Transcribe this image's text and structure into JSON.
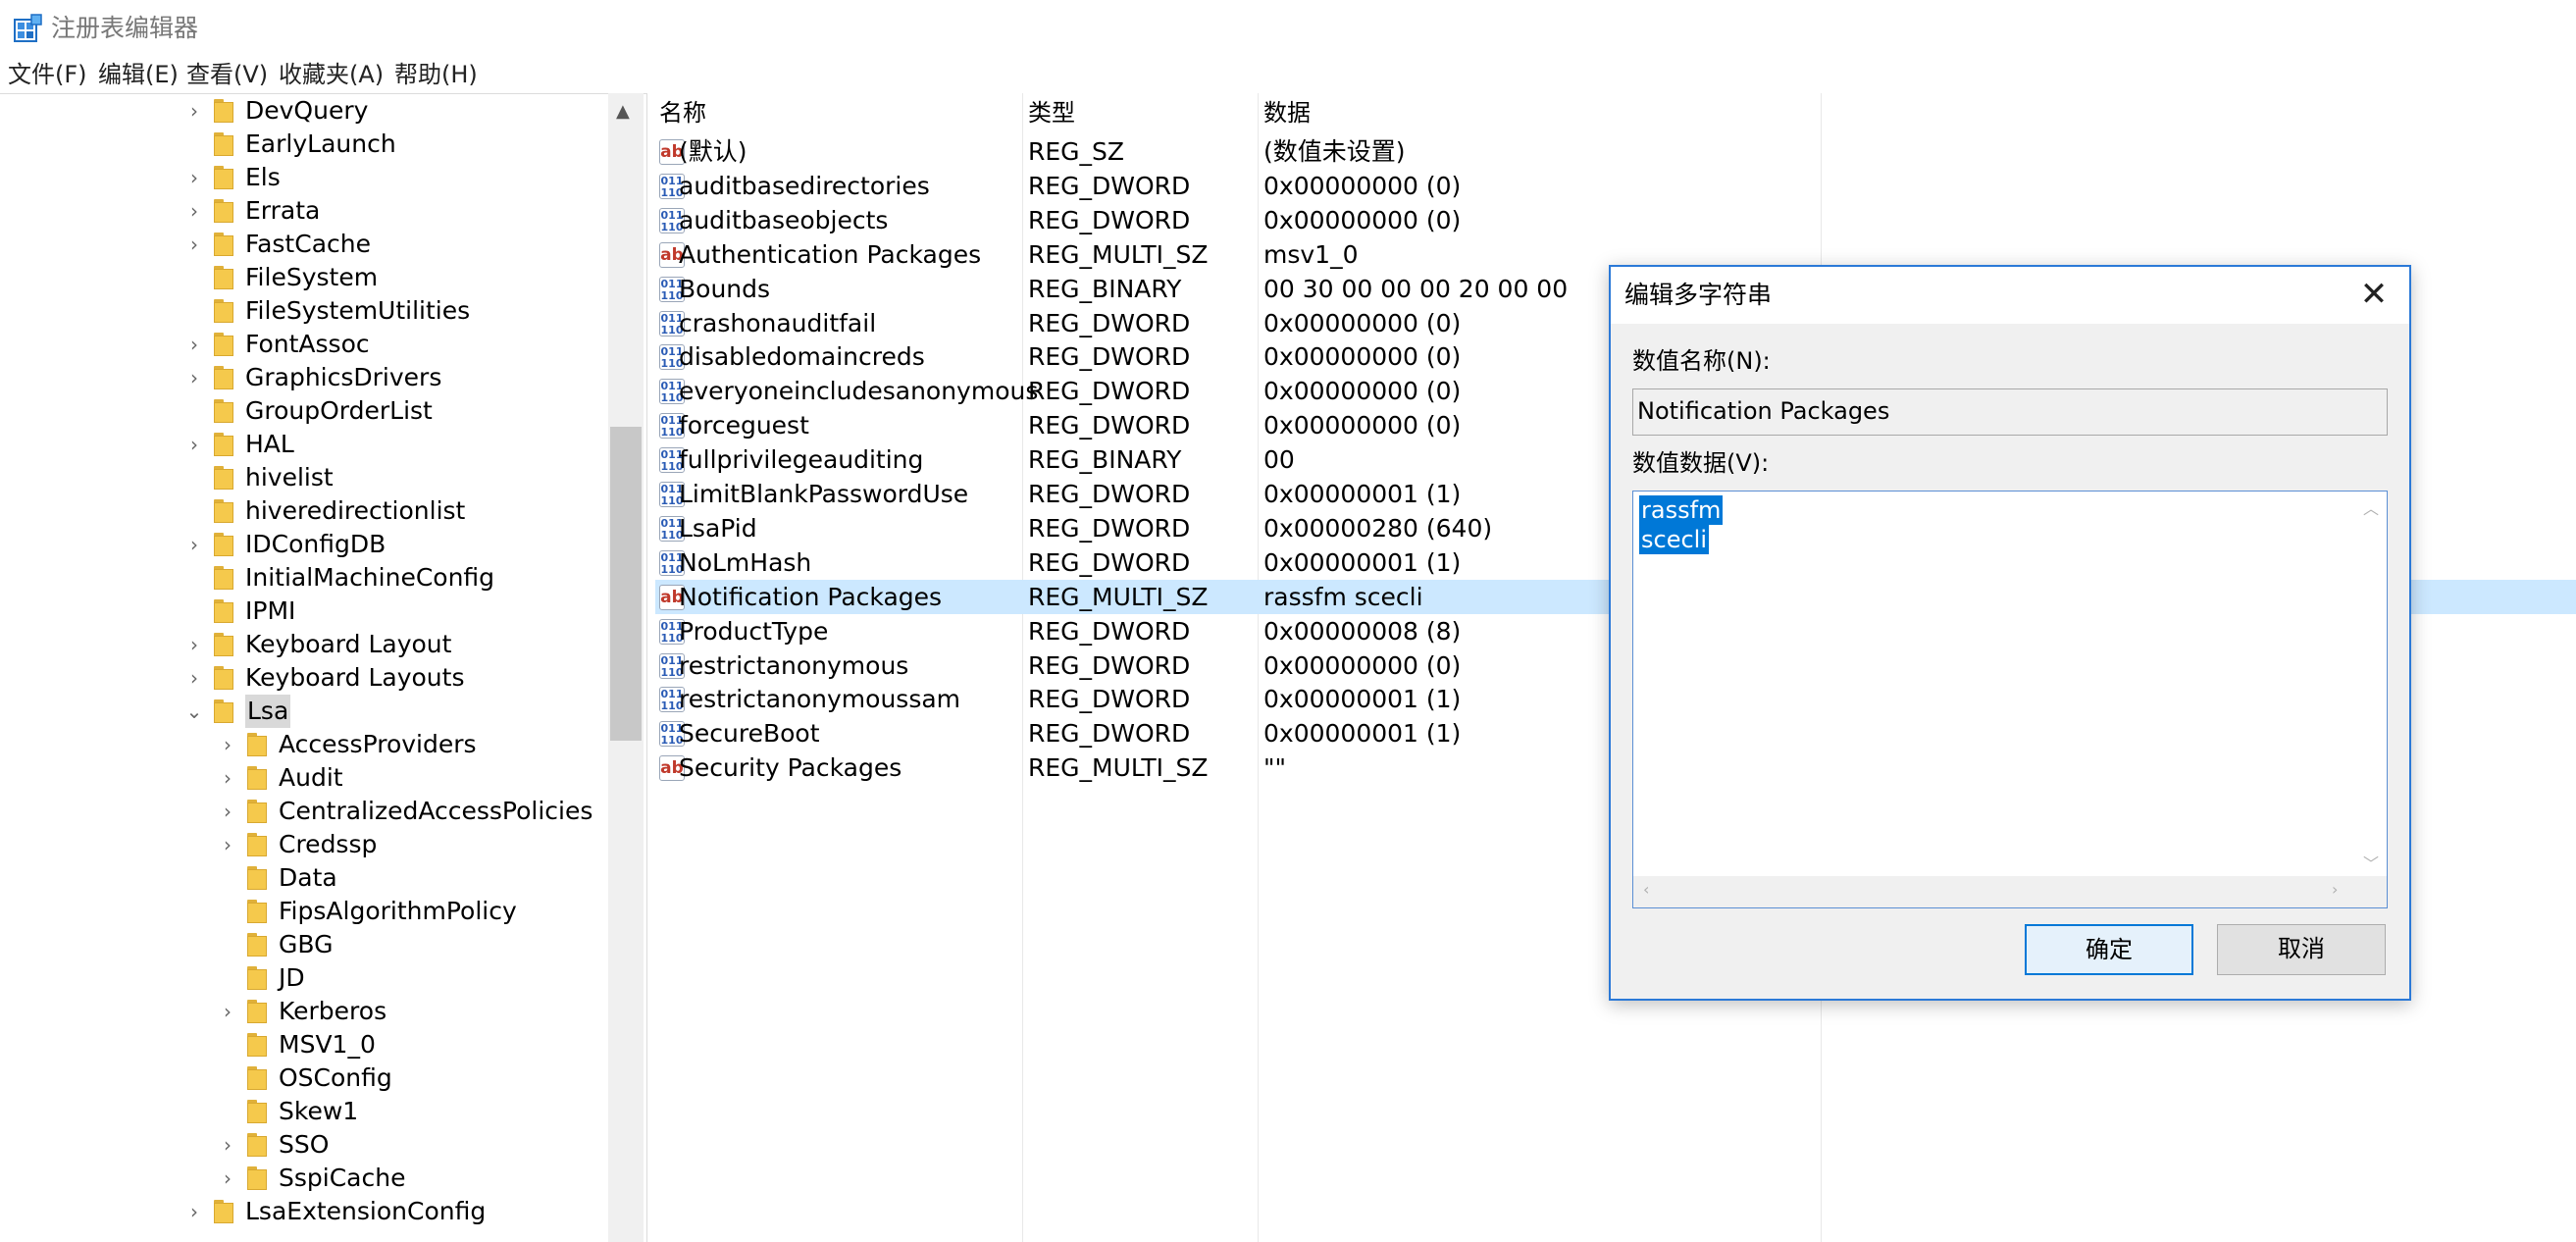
{
  "window": {
    "title": "注册表编辑器",
    "icon": "registry-editor-icon"
  },
  "menu": [
    "文件(F)",
    "编辑(E)",
    "查看(V)",
    "收藏夹(A)",
    "帮助(H)"
  ],
  "tree": {
    "scroll_up_glyph": "▲",
    "items": [
      {
        "label": "DevQuery",
        "level": 0,
        "expander": "collapsed"
      },
      {
        "label": "EarlyLaunch",
        "level": 0,
        "expander": "none"
      },
      {
        "label": "Els",
        "level": 0,
        "expander": "collapsed"
      },
      {
        "label": "Errata",
        "level": 0,
        "expander": "collapsed"
      },
      {
        "label": "FastCache",
        "level": 0,
        "expander": "collapsed"
      },
      {
        "label": "FileSystem",
        "level": 0,
        "expander": "none"
      },
      {
        "label": "FileSystemUtilities",
        "level": 0,
        "expander": "none"
      },
      {
        "label": "FontAssoc",
        "level": 0,
        "expander": "collapsed"
      },
      {
        "label": "GraphicsDrivers",
        "level": 0,
        "expander": "collapsed"
      },
      {
        "label": "GroupOrderList",
        "level": 0,
        "expander": "none"
      },
      {
        "label": "HAL",
        "level": 0,
        "expander": "collapsed"
      },
      {
        "label": "hivelist",
        "level": 0,
        "expander": "none"
      },
      {
        "label": "hiveredirectionlist",
        "level": 0,
        "expander": "none"
      },
      {
        "label": "IDConfigDB",
        "level": 0,
        "expander": "collapsed"
      },
      {
        "label": "InitialMachineConfig",
        "level": 0,
        "expander": "none"
      },
      {
        "label": "IPMI",
        "level": 0,
        "expander": "none"
      },
      {
        "label": "Keyboard Layout",
        "level": 0,
        "expander": "collapsed"
      },
      {
        "label": "Keyboard Layouts",
        "level": 0,
        "expander": "collapsed"
      },
      {
        "label": "Lsa",
        "level": 0,
        "expander": "expanded",
        "selected": true
      },
      {
        "label": "AccessProviders",
        "level": 1,
        "expander": "collapsed"
      },
      {
        "label": "Audit",
        "level": 1,
        "expander": "collapsed"
      },
      {
        "label": "CentralizedAccessPolicies",
        "level": 1,
        "expander": "collapsed"
      },
      {
        "label": "Credssp",
        "level": 1,
        "expander": "collapsed"
      },
      {
        "label": "Data",
        "level": 1,
        "expander": "none"
      },
      {
        "label": "FipsAlgorithmPolicy",
        "level": 1,
        "expander": "none"
      },
      {
        "label": "GBG",
        "level": 1,
        "expander": "none"
      },
      {
        "label": "JD",
        "level": 1,
        "expander": "none"
      },
      {
        "label": "Kerberos",
        "level": 1,
        "expander": "collapsed"
      },
      {
        "label": "MSV1_0",
        "level": 1,
        "expander": "none"
      },
      {
        "label": "OSConfig",
        "level": 1,
        "expander": "none"
      },
      {
        "label": "Skew1",
        "level": 1,
        "expander": "none"
      },
      {
        "label": "SSO",
        "level": 1,
        "expander": "collapsed"
      },
      {
        "label": "SspiCache",
        "level": 1,
        "expander": "collapsed"
      },
      {
        "label": "LsaExtensionConfig",
        "level": 0,
        "expander": "collapsed"
      }
    ]
  },
  "list": {
    "columns": [
      "名称",
      "类型",
      "数据"
    ],
    "rows": [
      {
        "icon": "ab",
        "name": "(默认)",
        "type": "REG_SZ",
        "data": "(数值未设置)"
      },
      {
        "icon": "bin",
        "name": "auditbasedirectories",
        "type": "REG_DWORD",
        "data": "0x00000000 (0)"
      },
      {
        "icon": "bin",
        "name": "auditbaseobjects",
        "type": "REG_DWORD",
        "data": "0x00000000 (0)"
      },
      {
        "icon": "ab",
        "name": "Authentication Packages",
        "type": "REG_MULTI_SZ",
        "data": "msv1_0"
      },
      {
        "icon": "bin",
        "name": "Bounds",
        "type": "REG_BINARY",
        "data": "00 30 00 00 00 20 00 00"
      },
      {
        "icon": "bin",
        "name": "crashonauditfail",
        "type": "REG_DWORD",
        "data": "0x00000000 (0)"
      },
      {
        "icon": "bin",
        "name": "disabledomaincreds",
        "type": "REG_DWORD",
        "data": "0x00000000 (0)"
      },
      {
        "icon": "bin",
        "name": "everyoneincludesanonymous",
        "type": "REG_DWORD",
        "data": "0x00000000 (0)"
      },
      {
        "icon": "bin",
        "name": "forceguest",
        "type": "REG_DWORD",
        "data": "0x00000000 (0)"
      },
      {
        "icon": "bin",
        "name": "fullprivilegeauditing",
        "type": "REG_BINARY",
        "data": "00"
      },
      {
        "icon": "bin",
        "name": "LimitBlankPasswordUse",
        "type": "REG_DWORD",
        "data": "0x00000001 (1)"
      },
      {
        "icon": "bin",
        "name": "LsaPid",
        "type": "REG_DWORD",
        "data": "0x00000280 (640)"
      },
      {
        "icon": "bin",
        "name": "NoLmHash",
        "type": "REG_DWORD",
        "data": "0x00000001 (1)"
      },
      {
        "icon": "ab",
        "name": "Notification Packages",
        "type": "REG_MULTI_SZ",
        "data": "rassfm scecli",
        "highlight": true
      },
      {
        "icon": "bin",
        "name": "ProductType",
        "type": "REG_DWORD",
        "data": "0x00000008 (8)"
      },
      {
        "icon": "bin",
        "name": "restrictanonymous",
        "type": "REG_DWORD",
        "data": "0x00000000 (0)"
      },
      {
        "icon": "bin",
        "name": "restrictanonymoussam",
        "type": "REG_DWORD",
        "data": "0x00000001 (1)"
      },
      {
        "icon": "bin",
        "name": "SecureBoot",
        "type": "REG_DWORD",
        "data": "0x00000001 (1)"
      },
      {
        "icon": "ab",
        "name": "Security Packages",
        "type": "REG_MULTI_SZ",
        "data": "\"\""
      }
    ]
  },
  "dialog": {
    "title": "编辑多字符串",
    "close_glyph": "✕",
    "name_label": "数值名称(N):",
    "name_value": "Notification Packages",
    "data_label": "数值数据(V):",
    "data_lines": [
      "rassfm",
      "scecli"
    ],
    "ok_label": "确定",
    "cancel_label": "取消",
    "scroll_glyphs": {
      "up": "︿",
      "down": "﹀",
      "left": "‹",
      "right": "›"
    },
    "accent": "#0078d7"
  }
}
